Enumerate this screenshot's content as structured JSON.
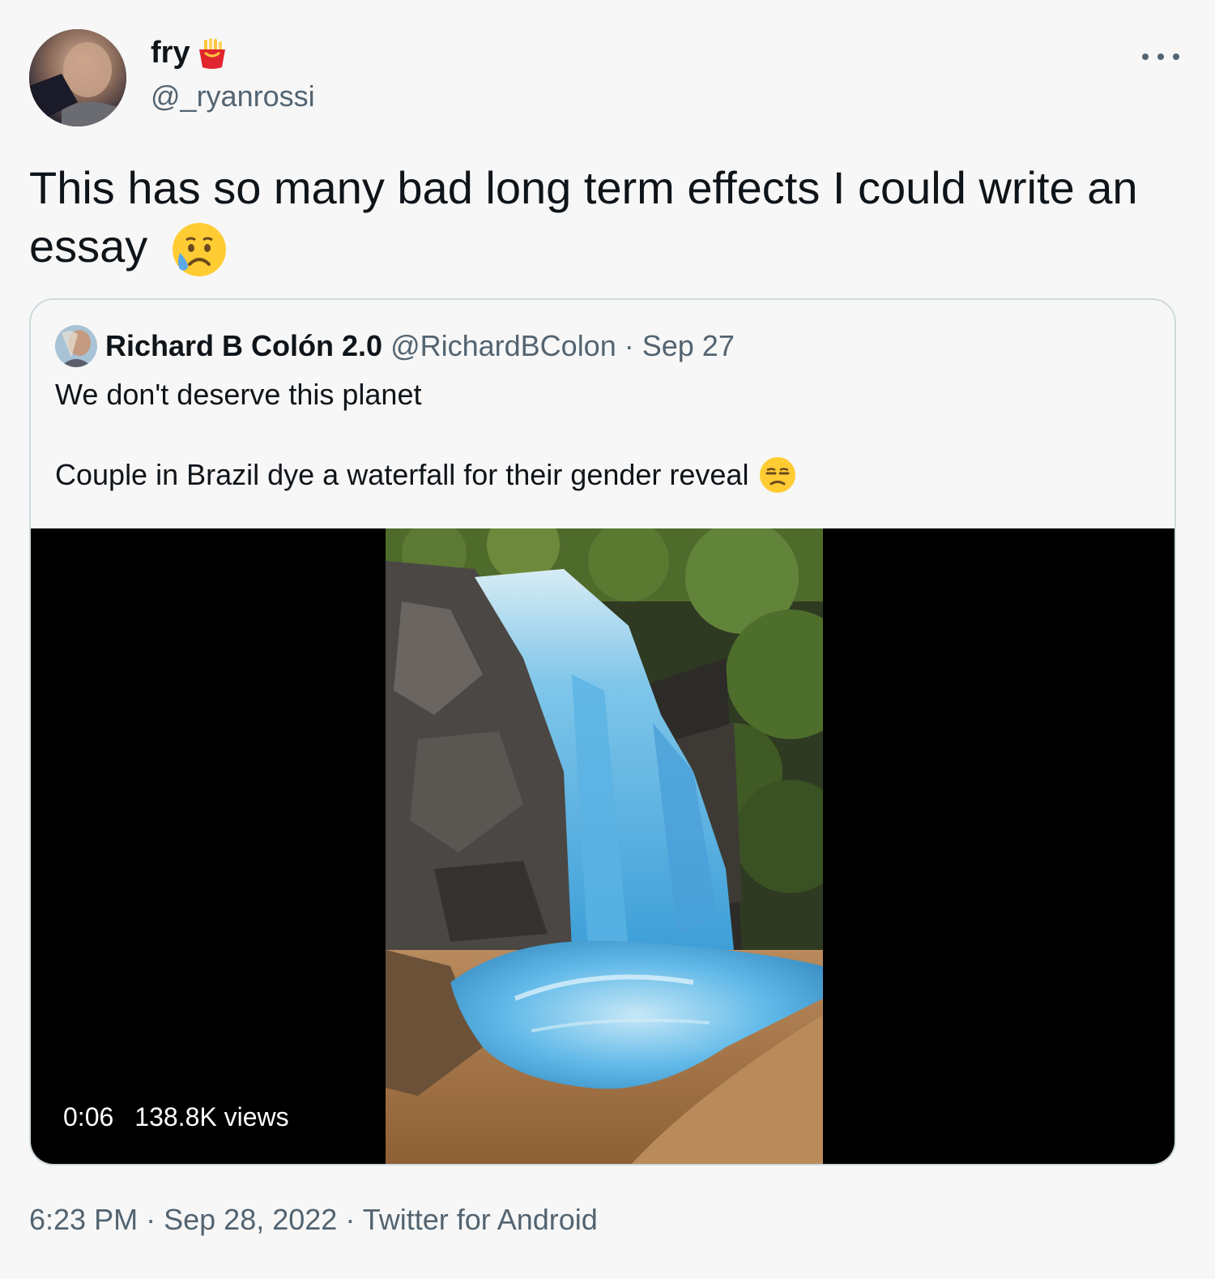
{
  "tweet": {
    "display_name": "fry",
    "handle": "@_ryanrossi",
    "text": "This has so many bad long term effects I could write an essay",
    "emoji": "sad-but-relieved-face",
    "timestamp_time": "6:23 PM",
    "timestamp_date": "Sep 28, 2022",
    "source": "Twitter for Android",
    "separator": "·"
  },
  "quoted_tweet": {
    "display_name": "Richard B Colón 2.0",
    "handle": "@RichardBColon",
    "separator": "·",
    "date": "Sep 27",
    "line1": "We don't deserve this planet",
    "line2": "Couple in Brazil dye a waterfall for their gender reveal",
    "emoji": "unamused-face",
    "media": {
      "type": "video",
      "duration": "0:06",
      "views": "138.8K views"
    }
  },
  "colors": {
    "text_primary": "#0f1419",
    "text_secondary": "#536471",
    "border": "#cfd9de",
    "background": "#f7f7f7",
    "video_background": "#000000",
    "dyed_water": "#4ab3ea"
  }
}
